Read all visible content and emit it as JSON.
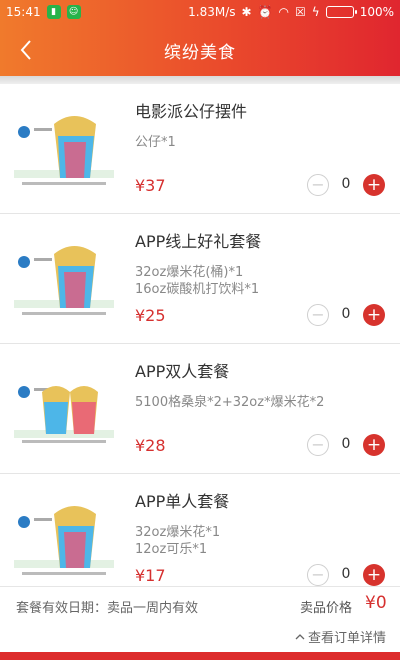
{
  "status_bar": {
    "time": "15:41",
    "network_speed": "1.83M/s",
    "battery": "100%"
  },
  "header": {
    "title": "缤纷美食"
  },
  "items": [
    {
      "name": "电影派公仔摆件",
      "desc": "公仔*1",
      "price": "¥37",
      "qty": "0"
    },
    {
      "name": "APP线上好礼套餐",
      "desc": "32oz爆米花(桶)*1\n16oz碳酸机打饮料*1",
      "price": "¥25",
      "qty": "0"
    },
    {
      "name": "APP双人套餐",
      "desc": "5100格桑泉*2+32oz*爆米花*2",
      "price": "¥28",
      "qty": "0"
    },
    {
      "name": "APP单人套餐",
      "desc": "32oz爆米花*1\n12oz可乐*1",
      "price": "¥17",
      "qty": "0"
    }
  ],
  "footer": {
    "validity": "套餐有效日期：卖品一周内有效",
    "price_label": "卖品价格",
    "total": "¥0",
    "details_link": "查看订单详情"
  },
  "colors": {
    "accent": "#e0262f",
    "header_gradient_start": "#f07a2c",
    "price": "#d6302f"
  }
}
